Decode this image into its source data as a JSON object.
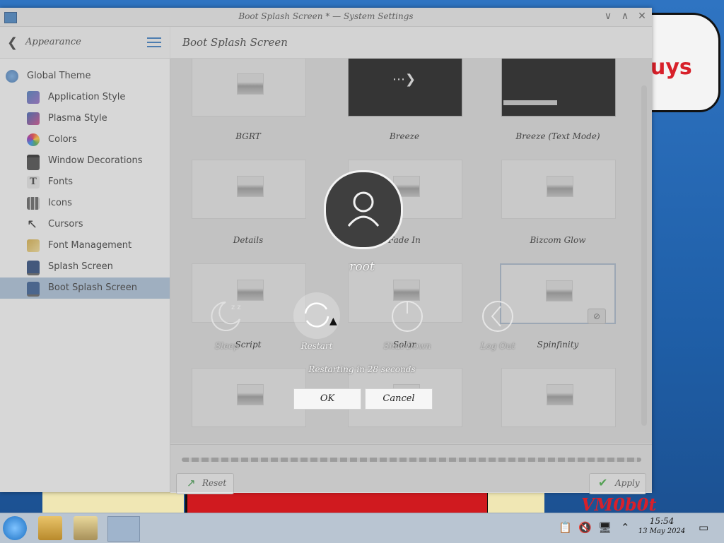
{
  "window": {
    "title": "Boot Splash Screen * — System Settings",
    "controls": [
      "∨",
      "∧",
      "✕"
    ]
  },
  "sidebar": {
    "header": "Appearance",
    "items": [
      {
        "label": "Global Theme",
        "icon": "globe-icon"
      },
      {
        "label": "Application Style",
        "icon": "brush-icon"
      },
      {
        "label": "Plasma Style",
        "icon": "plasma-icon"
      },
      {
        "label": "Colors",
        "icon": "color-wheel-icon"
      },
      {
        "label": "Window Decorations",
        "icon": "window-icon"
      },
      {
        "label": "Fonts",
        "icon": "font-icon"
      },
      {
        "label": "Icons",
        "icon": "icons-icon"
      },
      {
        "label": "Cursors",
        "icon": "cursor-icon"
      },
      {
        "label": "Font Management",
        "icon": "font-management-icon"
      },
      {
        "label": "Splash Screen",
        "icon": "monitor-icon"
      },
      {
        "label": "Boot Splash Screen",
        "icon": "boot-monitor-icon",
        "selected": true
      }
    ]
  },
  "page": {
    "title": "Boot Splash Screen",
    "themes": [
      "BGRT",
      "Breeze",
      "Breeze (Text Mode)",
      "Details",
      "Fade In",
      "Bizcom Glow",
      "Script",
      "Solar",
      "Spinfinity"
    ]
  },
  "footer": {
    "reset_label": "Reset",
    "apply_label": "Apply"
  },
  "logout_dialog": {
    "username": "root",
    "actions": [
      {
        "label": "Sleep",
        "icon": "sleep-icon"
      },
      {
        "label": "Restart",
        "icon": "restart-icon"
      },
      {
        "label": "Shut Down",
        "icon": "power-icon"
      },
      {
        "label": "Log Out",
        "icon": "logout-icon"
      }
    ],
    "countdown": "Restarting in 28 seconds",
    "ok_label": "OK",
    "cancel_label": "Cancel"
  },
  "taskbar": {
    "time": "15:54",
    "date": "13 May 2024"
  },
  "wallpaper": {
    "bubble_text": "uys",
    "corner_text": "VM0b0t"
  },
  "colors": {
    "accent": "#2d6fb6",
    "selected_item": "#9fb4cc",
    "apply_check": "#3aa23a",
    "reset_arrow": "#2e8b3a"
  }
}
